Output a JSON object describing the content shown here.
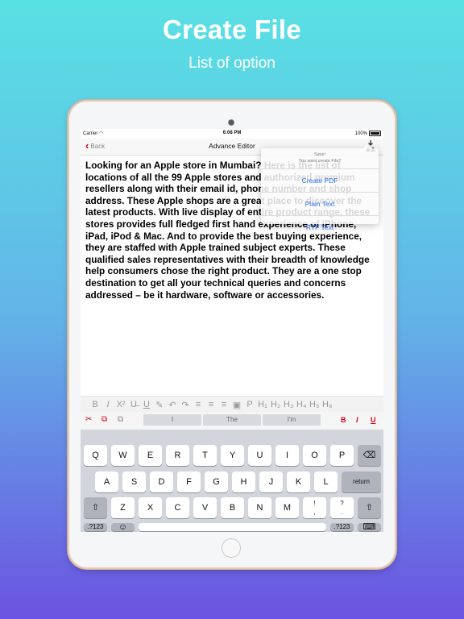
{
  "hero": {
    "title": "Create File",
    "subtitle": "List of option"
  },
  "status_bar": {
    "carrier": "Carrier",
    "time": "6:08 PM",
    "battery": "100%"
  },
  "nav": {
    "back_label": "Back",
    "title": "Advance Editor",
    "download_icon": "download-icon"
  },
  "editor": {
    "text": "Looking for an Apple store in Mumbai? Here is the list of locations of all the 99 Apple stores and authorized premium resellers along with their email id, phone number and shop address. These Apple shops are a great place to discover the latest products. With live display of entire product range, these stores provides full fledged first hand experience of iPhone, iPad, iPod & Mac. And to provide the best buying experience, they are staffed with Apple trained subject experts. These qualified sales representatives with their breadth of knowledge help consumers chose the right product. They are a one stop destination to get all your technical queries and concerns addressed – be it hardware, software or accessories."
  },
  "popover": {
    "title": "Save!",
    "message": "You want create File?",
    "actions": [
      "Create PDF",
      "Plain Text",
      "RTF Text"
    ],
    "action_color": "#2a6ff0"
  },
  "format_toolbar": {
    "items": [
      "B",
      "I",
      "X²",
      "U̶",
      "U",
      "✎",
      "↶",
      "↷",
      "≡",
      "≡",
      "≡",
      "▣",
      "P",
      "H₁",
      "H₂",
      "H₃",
      "H₄",
      "H₅",
      "H₆"
    ]
  },
  "keyboard": {
    "tools": {
      "cut": "✂",
      "copy": "⧉",
      "paste": "⧉"
    },
    "suggestions": [
      "I",
      "The",
      "I'm"
    ],
    "format": {
      "bold": "B",
      "italic": "I",
      "underline": "U"
    },
    "row1": [
      "Q",
      "W",
      "E",
      "R",
      "T",
      "Y",
      "U",
      "I",
      "O",
      "P"
    ],
    "row2": [
      "A",
      "S",
      "D",
      "F",
      "G",
      "H",
      "J",
      "K",
      "L"
    ],
    "row3": [
      "Z",
      "X",
      "C",
      "V",
      "B",
      "N",
      "M",
      "!\n,",
      "?\n."
    ],
    "return_label": "return",
    "numbers_label": ".?123",
    "emoji": "☺",
    "shift": "⇧",
    "delete": "⌫",
    "dismiss": "⌨"
  },
  "colors": {
    "accent": "#d0021b",
    "link": "#2a6ff0"
  }
}
